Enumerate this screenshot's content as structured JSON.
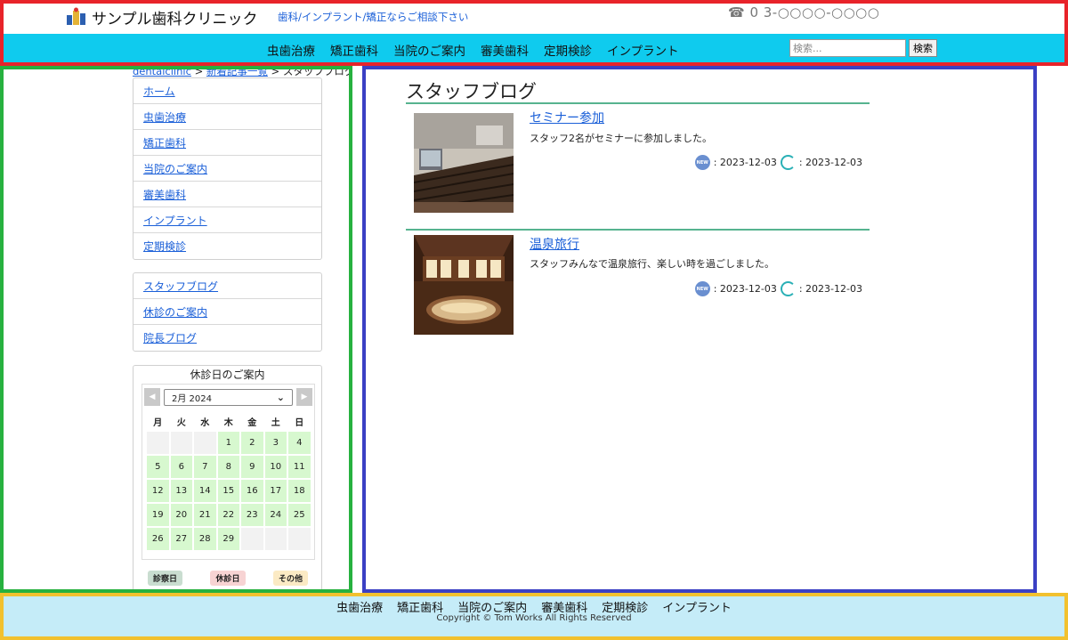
{
  "header": {
    "site_title": "サンプル歯科クリニック",
    "tagline": "歯科/インプラント/矯正ならご相談下さい",
    "phone": "☎ 0 3-○○○○-○○○○",
    "nav": [
      "虫歯治療",
      "矯正歯科",
      "当院のご案内",
      "審美歯科",
      "定期検診",
      "インプラント"
    ],
    "search": {
      "placeholder": "検索...",
      "button": "検索"
    }
  },
  "sidebar": {
    "breadcrumb": {
      "home": "dentalclinic",
      "sep1": " > ",
      "list": "新着記事一覧",
      "sep2": " > ",
      "current": "スタッフブログ"
    },
    "menu_main": [
      "ホーム",
      "虫歯治療",
      "矯正歯科",
      "当院のご案内",
      "審美歯科",
      "インプラント",
      "定期検診"
    ],
    "menu_sub": [
      "スタッフブログ",
      "休診のご案内",
      "院長ブログ"
    ],
    "calendar": {
      "title": "休診日のご案内",
      "month_label": "2月 2024",
      "weekdays": [
        "月",
        "火",
        "水",
        "木",
        "金",
        "土",
        "日"
      ],
      "leading_blanks": 3,
      "days": [
        "1",
        "2",
        "3",
        "4",
        "5",
        "6",
        "7",
        "8",
        "9",
        "10",
        "11",
        "12",
        "13",
        "14",
        "15",
        "16",
        "17",
        "18",
        "19",
        "20",
        "21",
        "22",
        "23",
        "24",
        "25",
        "26",
        "27",
        "28",
        "29"
      ],
      "trailing_blanks": 3,
      "legend": {
        "open": "診察日",
        "closed": "休診日",
        "other": "その他"
      }
    }
  },
  "main": {
    "page_title": "スタッフブログ",
    "posts": [
      {
        "title": "セミナー参加",
        "text": "スタッフ2名がセミナーに参加しました。",
        "posted": ": 2023-12-03",
        "updated": ": 2023-12-03",
        "new_label": "NEW"
      },
      {
        "title": "温泉旅行",
        "text": "スタッフみんなで温泉旅行、楽しい時を過ごしました。",
        "posted": ": 2023-12-03",
        "updated": ": 2023-12-03",
        "new_label": "NEW"
      }
    ]
  },
  "footer": {
    "nav": [
      "虫歯治療",
      "矯正歯科",
      "当院のご案内",
      "審美歯科",
      "定期検診",
      "インプラント"
    ],
    "copyright": "Copyright © Tom Works All Rights Reserved"
  },
  "colors": {
    "nav_bg": "#0fcbee",
    "footer_bg": "#c5ecf8",
    "accent_rule": "#56b38f",
    "link": "#1a5fd8"
  }
}
